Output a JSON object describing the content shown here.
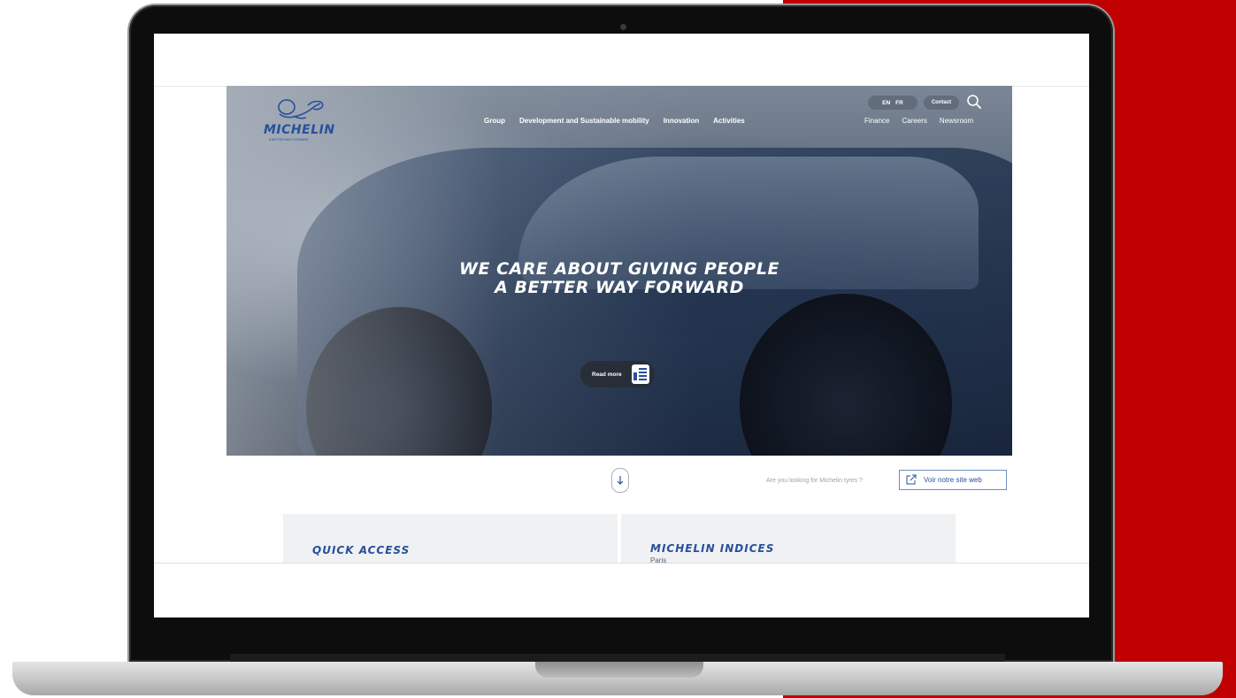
{
  "brand": {
    "logo_text": "MICHELIN",
    "tagline": "A BETTER WAY FORWARD",
    "color": "#27509b"
  },
  "header": {
    "lang": {
      "en": "EN",
      "fr": "FR"
    },
    "contact_label": "Contact",
    "main_nav": [
      "Group",
      "Development and Sustainable mobility",
      "Innovation",
      "Activities"
    ],
    "utility_nav": [
      "Finance",
      "Careers",
      "Newsroom"
    ]
  },
  "hero": {
    "headline_line1": "WE CARE ABOUT GIVING PEOPLE",
    "headline_line2": "A BETTER WAY FORWARD",
    "read_more_label": "Read more"
  },
  "below_hero": {
    "tyres_question": "Are you looking for Michelin tyres ?",
    "website_button_label": "Voir notre site web"
  },
  "cards": {
    "quick_access_title": "QUICK ACCESS",
    "indices_title": "MICHELIN INDICES",
    "indices_subtitle": "Paris"
  },
  "colors": {
    "accent_red": "#c00000",
    "brand_blue": "#27509b"
  },
  "icons": [
    "search-icon",
    "document-icon",
    "arrow-down-icon",
    "external-link-icon"
  ]
}
